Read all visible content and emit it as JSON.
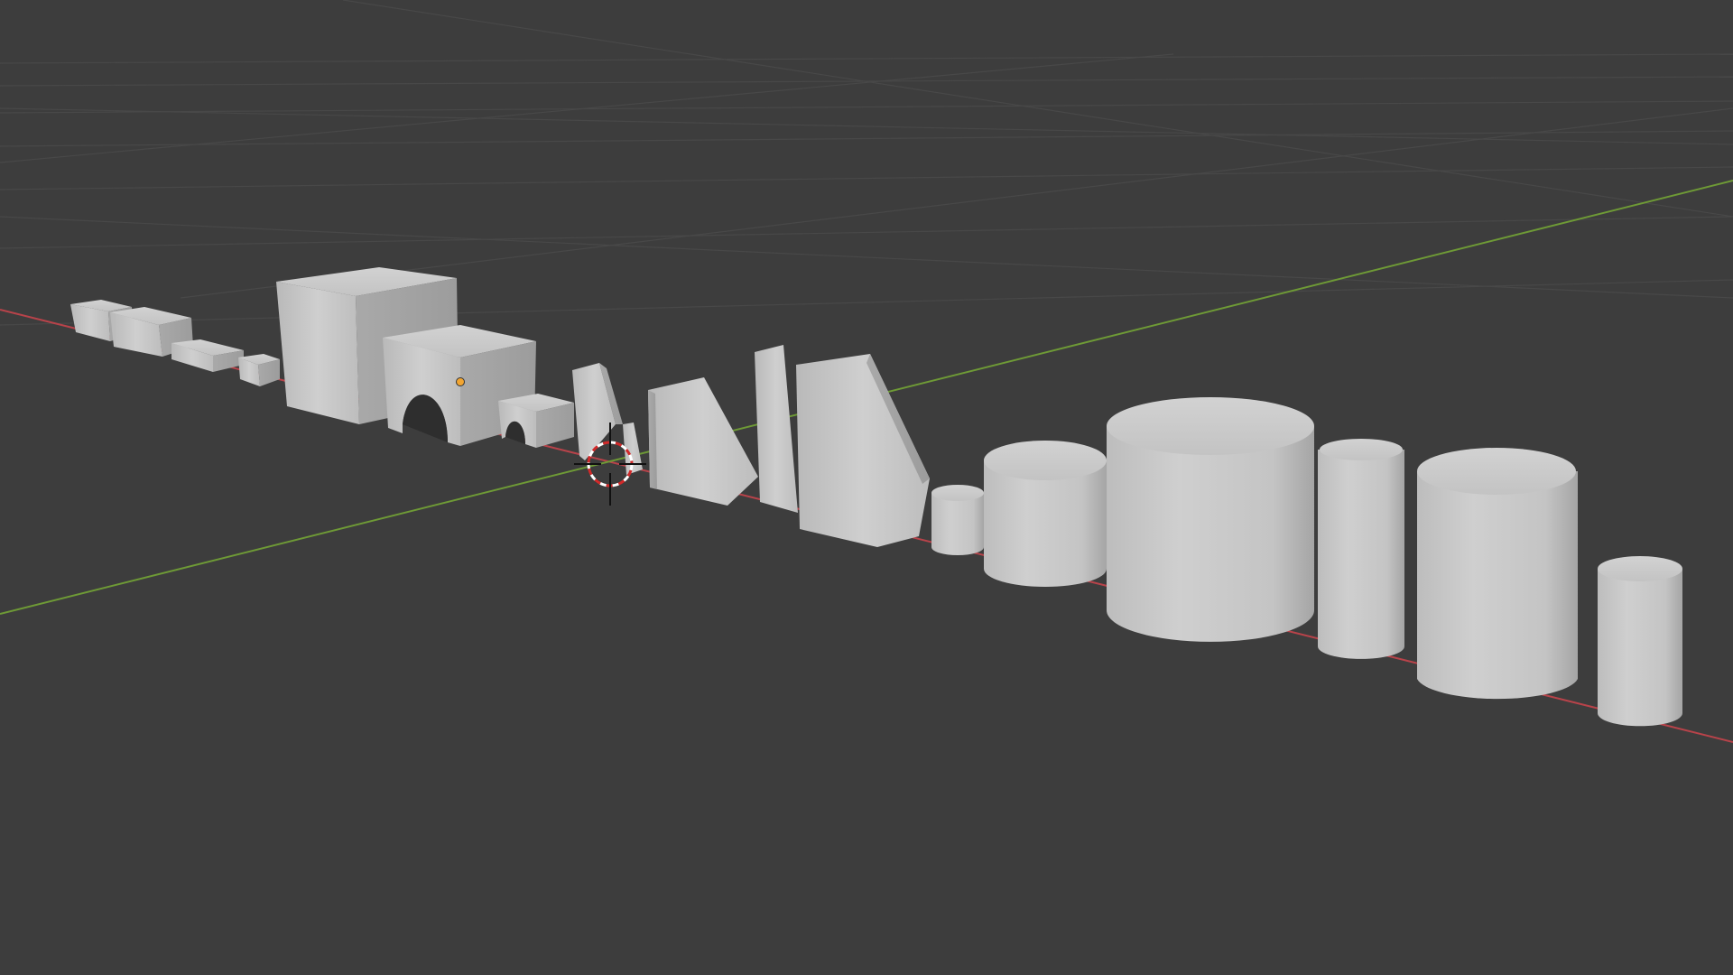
{
  "viewport": {
    "view": "3D Viewport",
    "shading": "solid",
    "background": "#3d3d3d",
    "grid_color": "#4a4a4a",
    "x_axis_color": "#b8434a",
    "y_axis_color": "#6e9a36",
    "object_color": "#c7c7c7",
    "origin_color": "#f2a531",
    "cursor_colors": [
      "#d12a2a",
      "#ffffff"
    ]
  },
  "scene": {
    "objects": [
      {
        "id": "slab-1",
        "kind": "block"
      },
      {
        "id": "slab-2",
        "kind": "block"
      },
      {
        "id": "slab-3",
        "kind": "block"
      },
      {
        "id": "slab-4",
        "kind": "block"
      },
      {
        "id": "cube-large",
        "kind": "cube"
      },
      {
        "id": "arch-large",
        "kind": "arch",
        "selected_origin": true
      },
      {
        "id": "arch-small",
        "kind": "arch"
      },
      {
        "id": "wedge-1",
        "kind": "wedge"
      },
      {
        "id": "wedge-2",
        "kind": "wedge"
      },
      {
        "id": "wedge-3",
        "kind": "wedge"
      },
      {
        "id": "wedge-4",
        "kind": "wedge"
      },
      {
        "id": "wedge-5",
        "kind": "wedge"
      },
      {
        "id": "cylinder-1",
        "kind": "cylinder"
      },
      {
        "id": "cylinder-2",
        "kind": "cylinder"
      },
      {
        "id": "cylinder-3",
        "kind": "cylinder"
      },
      {
        "id": "cylinder-4",
        "kind": "cylinder"
      },
      {
        "id": "cylinder-5",
        "kind": "cylinder"
      },
      {
        "id": "cylinder-6",
        "kind": "cylinder"
      }
    ],
    "cursor_3d": {
      "icon": "3d-cursor-icon"
    }
  }
}
